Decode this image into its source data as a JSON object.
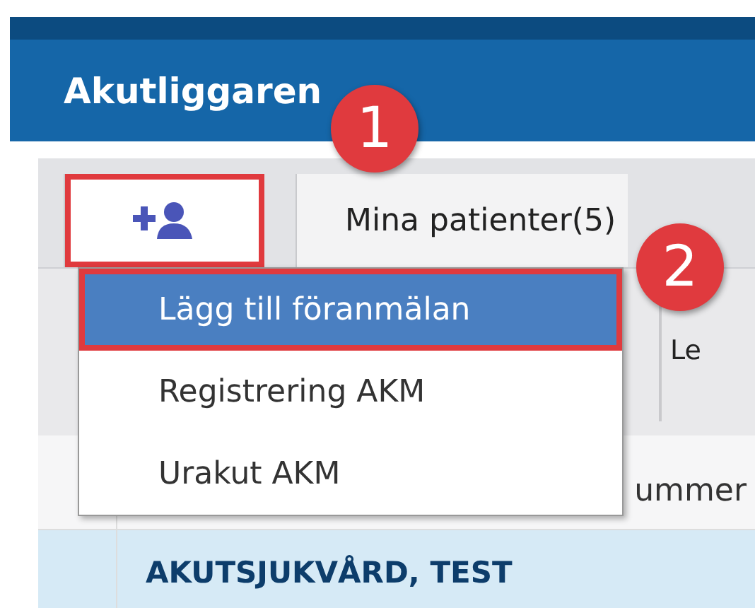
{
  "app": {
    "title": "Akutliggaren"
  },
  "tabs": [
    {
      "kind": "icon",
      "selected": true
    },
    {
      "kind": "text",
      "label": "Mina patienter(5)",
      "selected": false
    }
  ],
  "toolbar": {
    "column_label": "Le"
  },
  "table": {
    "header": "ummer",
    "rows": [
      {
        "text": "AKUTSJUKVÅRD, TEST",
        "selected": true
      }
    ]
  },
  "menu": [
    {
      "label": "Lägg till föranmälan",
      "selected": true
    },
    {
      "label": "Registrering AKM",
      "selected": false
    },
    {
      "label": "Urakut AKM",
      "selected": false
    }
  ],
  "callouts": [
    {
      "label": "1"
    },
    {
      "label": "2"
    }
  ]
}
